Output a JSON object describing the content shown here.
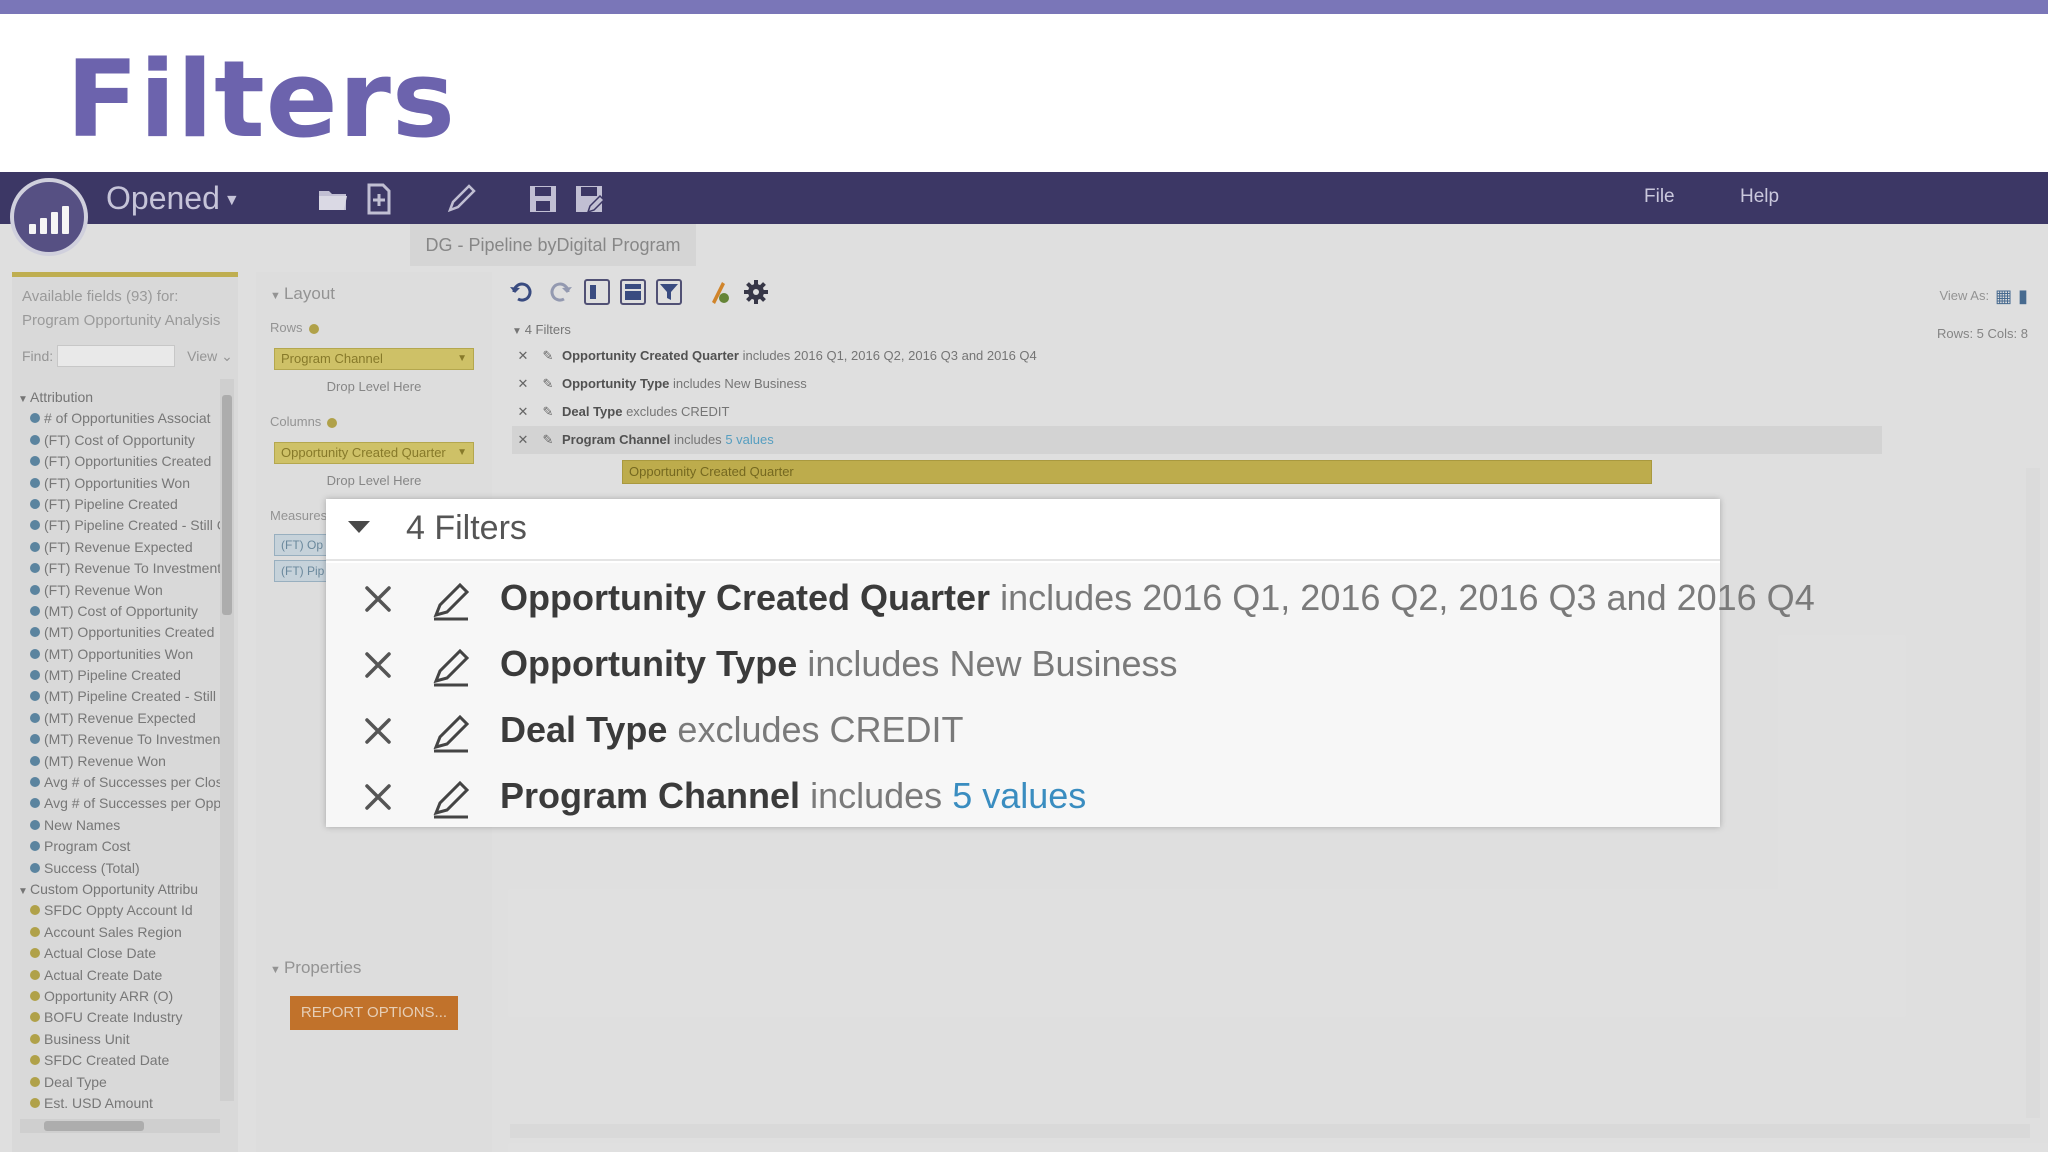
{
  "slide": {
    "title": "Filters"
  },
  "appbar": {
    "menu_label": "Opened",
    "file": "File",
    "help": "Help"
  },
  "doc_tab": "DG - Pipeline byDigital Program",
  "left_panel": {
    "available_line1": "Available fields (93) for:",
    "available_line2": "Program Opportunity Analysis",
    "find_label": "Find:",
    "view_label": "View",
    "groups": [
      {
        "name": "Attribution",
        "items": [
          "# of Opportunities Associat",
          "(FT) Cost of Opportunity",
          "(FT) Opportunities Created",
          "(FT) Opportunities Won",
          "(FT) Pipeline Created",
          "(FT) Pipeline Created - Still C",
          "(FT) Revenue Expected",
          "(FT) Revenue To Investment",
          "(FT) Revenue Won",
          "(MT) Cost of Opportunity",
          "(MT) Opportunities Created",
          "(MT) Opportunities Won",
          "(MT) Pipeline Created",
          "(MT) Pipeline Created - Still",
          "(MT) Revenue Expected",
          "(MT) Revenue To Investmen",
          "(MT) Revenue Won",
          "Avg # of Successes per Clos",
          "Avg # of Successes per Opp",
          "New Names",
          "Program Cost",
          "Success (Total)"
        ]
      },
      {
        "name": "Custom Opportunity Attribu",
        "items": [
          "SFDC Oppty Account Id",
          "Account Sales Region",
          "Actual Close Date",
          "Actual Create Date",
          "Opportunity ARR (O)",
          "BOFU Create Industry",
          "Business Unit",
          "SFDC Created Date",
          "Deal Type",
          "Est. USD Amount"
        ]
      }
    ]
  },
  "layout_panel": {
    "layout_label": "Layout",
    "rows_label": "Rows",
    "rows_value": "Program Channel",
    "drop_level": "Drop Level Here",
    "columns_label": "Columns",
    "columns_value": "Opportunity Created Quarter",
    "measures_label": "Measures",
    "measure_1": "(FT) Op",
    "measure_2": "(FT) Pip",
    "properties_label": "Properties",
    "report_options": "REPORT OPTIONS..."
  },
  "report": {
    "view_as": "View As:",
    "rows_cols": "Rows: 5  Cols: 8",
    "filters_count_label": "4 Filters",
    "column_header": "Opportunity Created Quarter"
  },
  "filters": [
    {
      "name": "Opportunity Created Quarter",
      "op": "includes",
      "value": "2016 Q1, 2016 Q2, 2016 Q3 and 2016 Q4",
      "is_link": false
    },
    {
      "name": "Opportunity Type",
      "op": "includes",
      "value": "New Business",
      "is_link": false
    },
    {
      "name": "Deal Type",
      "op": "excludes",
      "value": "CREDIT",
      "is_link": false
    },
    {
      "name": "Program Channel",
      "op": "includes",
      "value": "5 values",
      "is_link": true
    }
  ],
  "callout": {
    "title": "4 Filters"
  },
  "colors": {
    "accent_purple": "#6c63ad",
    "appbar": "#3f3a6a",
    "link_blue": "#3a8dc0",
    "report_button": "#c9772d",
    "layout_yellow": "#d7c96c"
  }
}
